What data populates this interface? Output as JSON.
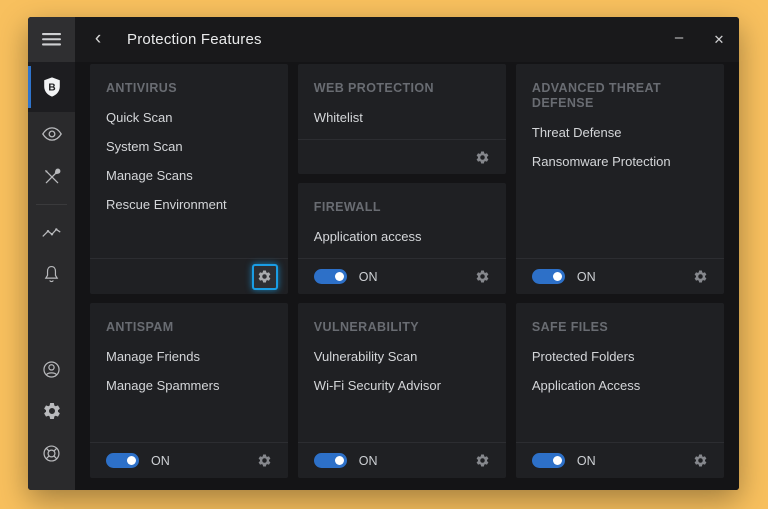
{
  "window": {
    "title": "Protection Features",
    "back_glyph": "‹",
    "minimize_glyph": "–",
    "close_glyph": "✕"
  },
  "sidebar": {
    "items": [
      {
        "id": "menu",
        "icon": "hamburger-icon"
      },
      {
        "id": "protection",
        "icon": "shield-icon",
        "active": true
      },
      {
        "id": "privacy",
        "icon": "eye-icon"
      },
      {
        "id": "utilities",
        "icon": "tools-icon"
      },
      {
        "id": "activity",
        "icon": "activity-icon"
      },
      {
        "id": "notifications",
        "icon": "bell-icon"
      },
      {
        "id": "account",
        "icon": "account-icon"
      },
      {
        "id": "settings",
        "icon": "gear-icon"
      },
      {
        "id": "support",
        "icon": "lifebuoy-icon"
      }
    ],
    "logo_letter": "B"
  },
  "labels": {
    "on": "ON"
  },
  "cards": {
    "antivirus": {
      "title": "ANTIVIRUS",
      "items": [
        "Quick Scan",
        "System Scan",
        "Manage Scans",
        "Rescue Environment"
      ],
      "gear_focused": true
    },
    "web_protection": {
      "title": "WEB PROTECTION",
      "items": [
        "Whitelist"
      ]
    },
    "firewall": {
      "title": "FIREWALL",
      "items": [
        "Application access"
      ],
      "toggle_state": "ON"
    },
    "advanced_threat_defense": {
      "title": "ADVANCED THREAT DEFENSE",
      "items": [
        "Threat Defense",
        "Ransomware Protection"
      ],
      "toggle_state": "ON"
    },
    "antispam": {
      "title": "ANTISPAM",
      "items": [
        "Manage Friends",
        "Manage Spammers"
      ],
      "toggle_state": "ON"
    },
    "vulnerability": {
      "title": "VULNERABILITY",
      "items": [
        "Vulnerability Scan",
        "Wi-Fi Security Advisor"
      ],
      "toggle_state": "ON"
    },
    "safe_files": {
      "title": "SAFE FILES",
      "items": [
        "Protected Folders",
        "Application Access"
      ],
      "toggle_state": "ON"
    }
  },
  "colors": {
    "desktop_orange": "#F8C05E",
    "toggle_blue": "#2D70C8",
    "focus_blue": "#1A9DE4",
    "active_indicator_blue": "#2F74CC",
    "card_background": "#1F2023"
  }
}
